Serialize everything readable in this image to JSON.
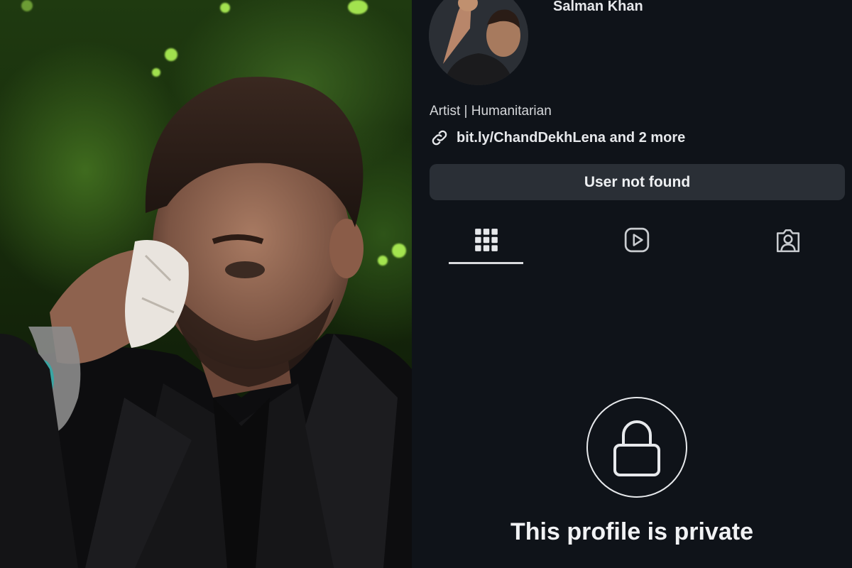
{
  "profile": {
    "display_name": "Salman Khan",
    "bio": "Artist | Humanitarian",
    "link_text": "bit.ly/ChandDekhLena and 2 more",
    "action_button_label": "User not found",
    "avatar_icon": "profile-photo"
  },
  "tabs": [
    {
      "name": "posts-grid",
      "icon": "grid-icon",
      "selected": true
    },
    {
      "name": "reels",
      "icon": "reels-icon",
      "selected": false
    },
    {
      "name": "tagged",
      "icon": "tagged-person-icon",
      "selected": false
    }
  ],
  "private_notice": {
    "icon": "lock-icon",
    "title": "This profile is private"
  },
  "colors": {
    "panel_background": "#0f1319",
    "button_background": "#2a2f36",
    "text_primary": "#e8eaed"
  }
}
